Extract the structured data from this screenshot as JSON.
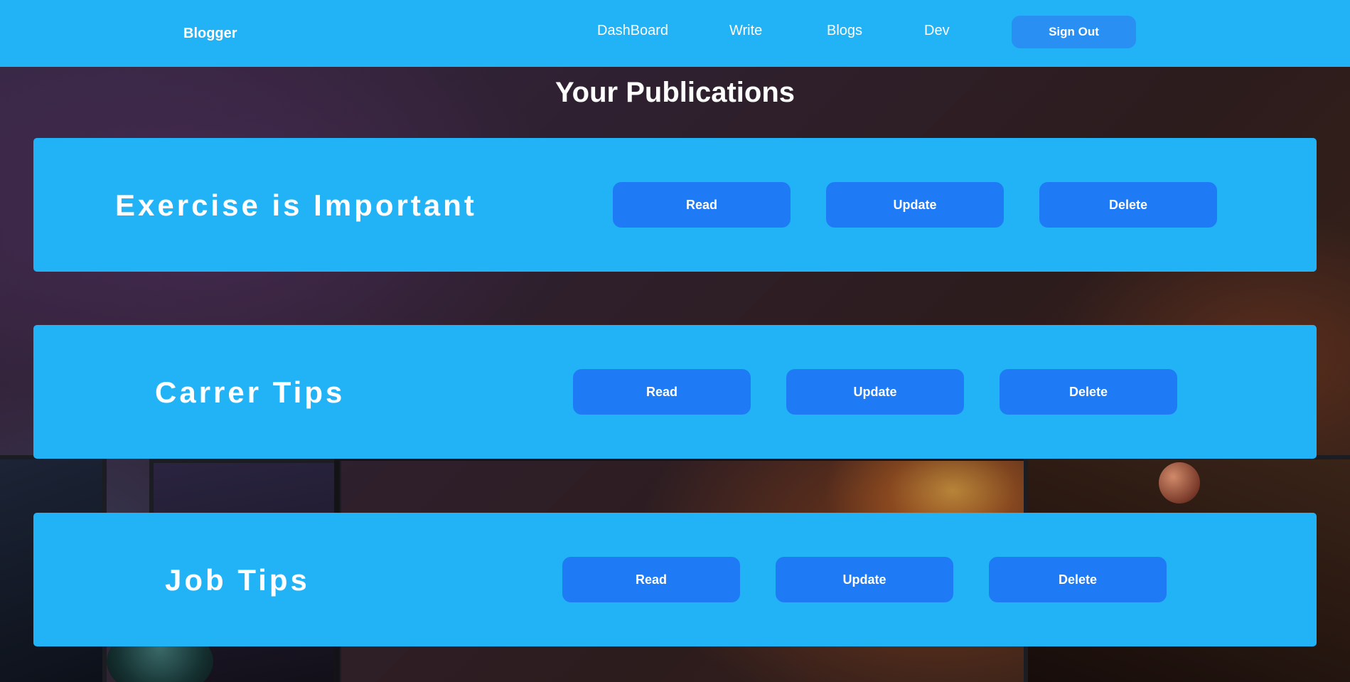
{
  "navbar": {
    "brand": "Blogger",
    "links": [
      "DashBoard",
      "Write",
      "Blogs",
      "Dev"
    ],
    "sign_out": "Sign Out"
  },
  "page_title": "Your Publications",
  "publications": [
    {
      "title": "Exercise is Important",
      "read": "Read",
      "update": "Update",
      "delete": "Delete"
    },
    {
      "title": "Carrer Tips",
      "read": "Read",
      "update": "Update",
      "delete": "Delete"
    },
    {
      "title": "Job Tips",
      "read": "Read",
      "update": "Update",
      "delete": "Delete"
    }
  ],
  "colors": {
    "primary": "#22b2f6",
    "button": "#1f7af5",
    "sign_out_button": "#2a8ff2",
    "text": "#ffffff"
  }
}
